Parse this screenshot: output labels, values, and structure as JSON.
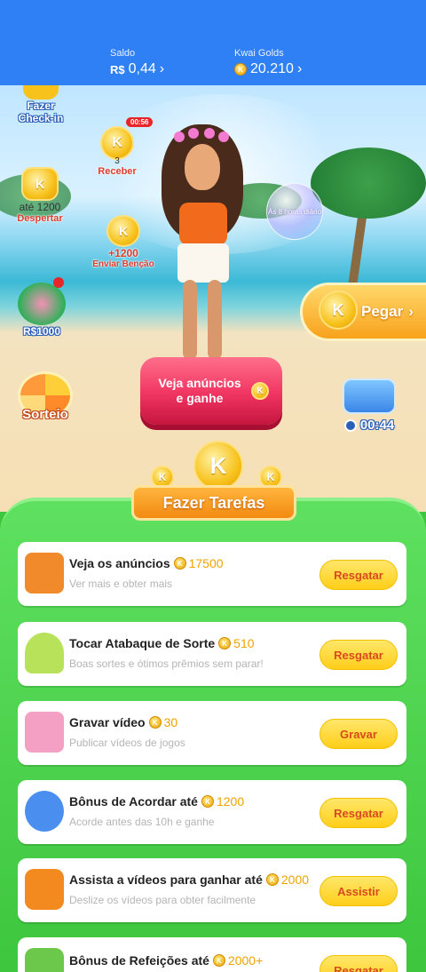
{
  "header": {
    "saldo_label": "Saldo",
    "saldo_currency": "R$",
    "saldo_value": "0,44",
    "golds_label": "Kwai Golds",
    "golds_value": "20.210",
    "chevron": "›"
  },
  "widgets": {
    "checkin_label": "Fazer\nCheck-in",
    "receber_timer": "00:56",
    "receber_count": "3",
    "receber_label": "Receber",
    "despertar_amount": "até 1200",
    "despertar_label": "Despertar",
    "bencao_amount": "+1200",
    "bencao_label": "Enviar Benção",
    "bubble_text": "Às 8 horas diário",
    "money_label": "R$1000",
    "sorteio_label": "Sorteio",
    "pegar_label": "Pegar",
    "ads_label": "Veja anúncios e ganhe",
    "chest_timer": "00:44",
    "coin_letter": "K"
  },
  "tasks_banner": {
    "title": "Fazer Tarefas"
  },
  "tasks": [
    {
      "title": "Veja os anúncios",
      "reward": "17500",
      "subtitle": "Ver mais e obter mais",
      "button": "Resgatar",
      "icon": "tv-icon"
    },
    {
      "title": "Tocar Atabaque de Sorte",
      "reward": "510",
      "subtitle": "Boas sortes e ótimos prêmios sem parar!",
      "button": "Resgatar",
      "icon": "drum-icon"
    },
    {
      "title": "Gravar vídeo",
      "reward": "30",
      "subtitle": "Publicar vídeos de jogos",
      "button": "Gravar",
      "icon": "video-icon"
    },
    {
      "title": "Bônus de Acordar até",
      "reward": "1200",
      "subtitle": "Acorde antes das 10h e ganhe",
      "button": "Resgatar",
      "icon": "alarm-icon"
    },
    {
      "title": "Assista a vídeos para ganhar até",
      "reward": "2000",
      "subtitle": "Deslize os vídeos para obter facilmente",
      "button": "Assistir",
      "icon": "camera-icon"
    },
    {
      "title": "Bônus de Refeições até",
      "reward": "2000+",
      "subtitle": "",
      "button": "Resgatar",
      "icon": "meal-icon"
    }
  ],
  "colors": {
    "header": "#2f7ff5",
    "panel": "#3ec63e",
    "coin": "#f7c21c",
    "button": "#ffce1a",
    "ads_button": "#f03462"
  }
}
